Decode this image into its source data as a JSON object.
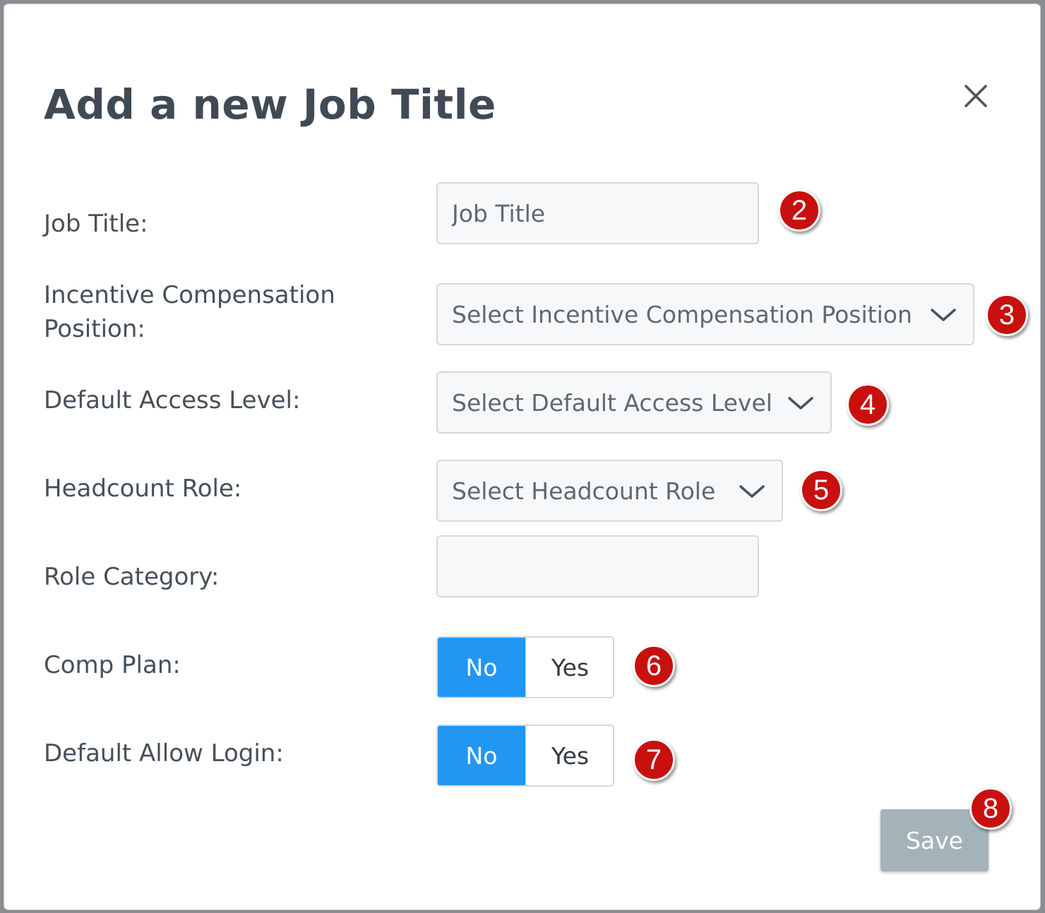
{
  "modal": {
    "title": "Add a new Job Title",
    "close_icon": "close-icon"
  },
  "form": {
    "job_title": {
      "label": "Job Title:",
      "placeholder": "Job Title",
      "value": ""
    },
    "incentive_position": {
      "label_line1": "Incentive Compensation",
      "label_line2": "Position:",
      "selected": "Select Incentive Compensation Position"
    },
    "access_level": {
      "label": "Default Access Level:",
      "selected": "Select Default Access Level"
    },
    "headcount_role": {
      "label": "Headcount Role:",
      "selected": "Select Headcount Role"
    },
    "role_category": {
      "label": "Role Category:",
      "value": ""
    },
    "comp_plan": {
      "label": "Comp Plan:",
      "options": [
        "No",
        "Yes"
      ],
      "selected": "No"
    },
    "allow_login": {
      "label": "Default Allow Login:",
      "options": [
        "No",
        "Yes"
      ],
      "selected": "No"
    }
  },
  "actions": {
    "save_label": "Save"
  },
  "callouts": [
    "2",
    "3",
    "4",
    "5",
    "6",
    "7",
    "8"
  ],
  "colors": {
    "toggle_active": "#2196f3",
    "save_disabled": "#a4b2ba",
    "callout": "#c8100e",
    "title": "#404a54"
  }
}
